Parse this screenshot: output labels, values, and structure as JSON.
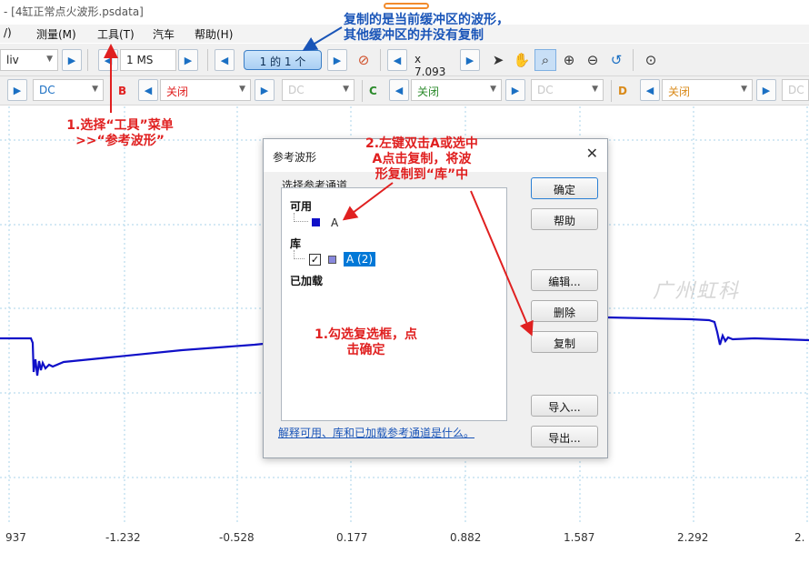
{
  "titlebar": {
    "title": "- [4缸正常点火波形.psdata]"
  },
  "menubar": {
    "items": [
      "/)",
      "测量(M)",
      "工具(T)",
      "汽车",
      "帮助(H)"
    ]
  },
  "toolbar1": {
    "div_combo": "liv",
    "timebase": "1 MS",
    "buffer_counter": "1 的 1 个",
    "zoom_value": "x 7.093"
  },
  "toolbar2": {
    "channel_a_coupling": "DC",
    "channel_b_label": "B",
    "channel_b_range": "关闭",
    "channel_b_coupling": "DC",
    "channel_c_label": "C",
    "channel_c_range": "关闭",
    "channel_c_coupling": "DC",
    "channel_d_label": "D",
    "channel_d_range": "关闭",
    "channel_e_coupling": "DC"
  },
  "colors": {
    "channel_a": "#1010c8",
    "channel_b": "#e02020",
    "channel_c": "#2b8a2b",
    "channel_d": "#d98a1a",
    "accent": "#1a6fc3",
    "annotation_red": "#e02020",
    "annotation_blue": "#1a55b8"
  },
  "axis": {
    "ticks": [
      "937",
      "-1.232",
      "-0.528",
      "0.177",
      "0.882",
      "1.587",
      "2.292",
      "2."
    ]
  },
  "dialog": {
    "title": "参考波形",
    "group_label": "选择参考通道",
    "available_heading": "可用",
    "available_item": "A",
    "library_heading": "库",
    "library_item": "A (2)",
    "library_checked": true,
    "loaded_heading": "已加载",
    "buttons": {
      "ok": "确定",
      "help": "帮助",
      "edit": "编辑...",
      "delete": "删除",
      "copy": "复制",
      "import": "导入...",
      "export": "导出..."
    },
    "help_link": "解释可用、库和已加载参考通道是什么。"
  },
  "annotations": {
    "top_note_line1": "复制的是当前缓冲区的波形，",
    "top_note_line2": "其他缓冲区的并没有复制",
    "step1_tools_line1": "1.选择“工具”菜单",
    "step1_tools_line2": ">>“参考波形”",
    "step2_line1": "2.左键双击A或选中",
    "step2_line2": "A点击复制，将波",
    "step2_line3": "形复制到“库”中",
    "step_check_line1": "1.勾选复选框，点",
    "step_check_line2": "击确定"
  },
  "watermark": "广州虹科"
}
